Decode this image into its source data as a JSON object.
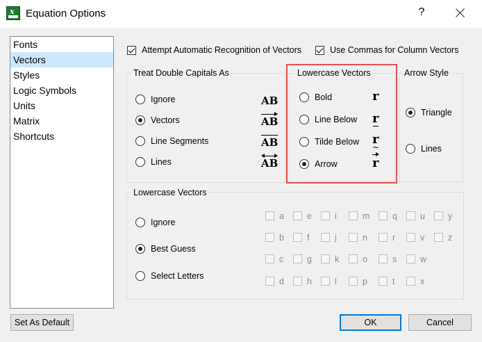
{
  "window": {
    "title": "Equation Options",
    "help": "?"
  },
  "sidebar": {
    "items": [
      "Fonts",
      "Vectors",
      "Styles",
      "Logic Symbols",
      "Units",
      "Matrix",
      "Shortcuts"
    ],
    "selected": 1
  },
  "top_checks": {
    "auto_recognition": {
      "label": "Attempt Automatic Recognition of Vectors",
      "checked": true
    },
    "commas": {
      "label": "Use Commas for Column Vectors",
      "checked": true
    }
  },
  "double_capitals": {
    "title": "Treat Double Capitals As",
    "options": [
      {
        "label": "Ignore",
        "symbol": "AB",
        "checked": false
      },
      {
        "label": "Vectors",
        "symbol": "AB",
        "checked": true
      },
      {
        "label": "Line Segments",
        "symbol": "AB",
        "checked": false
      },
      {
        "label": "Lines",
        "symbol": "AB",
        "checked": false
      }
    ]
  },
  "lowercase_style": {
    "title": "Lowercase Vectors",
    "options": [
      {
        "label": "Bold",
        "symbol": "r",
        "checked": false
      },
      {
        "label": "Line Below",
        "symbol": "r",
        "checked": false
      },
      {
        "label": "Tilde Below",
        "symbol": "r",
        "tilde": "~",
        "checked": false
      },
      {
        "label": "Arrow",
        "symbol": "r",
        "checked": true
      }
    ]
  },
  "arrow_style": {
    "title": "Arrow Style",
    "options": [
      {
        "label": "Triangle",
        "checked": true
      },
      {
        "label": "Lines",
        "checked": false
      }
    ]
  },
  "lowercase_vectors": {
    "title": "Lowercase Vectors",
    "options": [
      {
        "label": "Ignore",
        "checked": false
      },
      {
        "label": "Best Guess",
        "checked": true
      },
      {
        "label": "Select Letters",
        "checked": false
      }
    ],
    "letters": [
      [
        "a",
        "e",
        "i",
        "m",
        "q",
        "u",
        "y"
      ],
      [
        "b",
        "f",
        "j",
        "n",
        "r",
        "v",
        "z"
      ],
      [
        "c",
        "g",
        "k",
        "o",
        "s",
        "w"
      ],
      [
        "d",
        "h",
        "l",
        "p",
        "t",
        "x"
      ]
    ]
  },
  "buttons": {
    "set_default": "Set As Default",
    "ok": "OK",
    "cancel": "Cancel"
  },
  "colors": {
    "selection": "#cce8ff",
    "highlight_box": "#e4504e",
    "primary_border": "#0078d7"
  }
}
